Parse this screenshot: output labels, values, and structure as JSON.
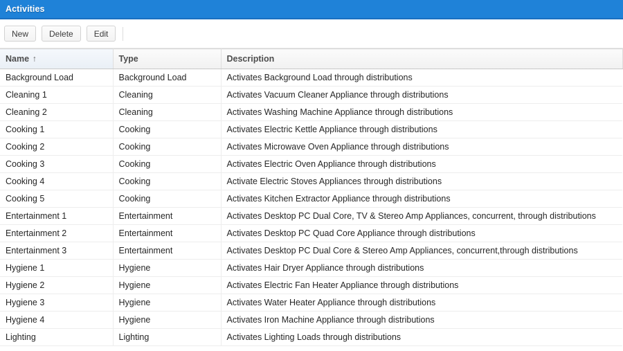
{
  "window": {
    "title": "Activities"
  },
  "toolbar": {
    "buttons": [
      {
        "label": "New",
        "name": "new-button"
      },
      {
        "label": "Delete",
        "name": "delete-button"
      },
      {
        "label": "Edit",
        "name": "edit-button"
      }
    ]
  },
  "grid": {
    "columns": [
      {
        "label": "Name",
        "sorted": true,
        "sort_indicator": "↑"
      },
      {
        "label": "Type",
        "sorted": false,
        "sort_indicator": ""
      },
      {
        "label": "Description",
        "sorted": false,
        "sort_indicator": ""
      }
    ],
    "rows": [
      {
        "name": "Background Load",
        "type": "Background Load",
        "description": "Activates Background Load through distributions"
      },
      {
        "name": "Cleaning 1",
        "type": "Cleaning",
        "description": "Activates Vacuum Cleaner Appliance through distributions"
      },
      {
        "name": "Cleaning 2",
        "type": "Cleaning",
        "description": "Activates Washing Machine Appliance through distributions"
      },
      {
        "name": "Cooking 1",
        "type": "Cooking",
        "description": "Activates Electric Kettle Appliance through distributions"
      },
      {
        "name": "Cooking 2",
        "type": "Cooking",
        "description": "Activates Microwave Oven Appliance through distributions"
      },
      {
        "name": "Cooking 3",
        "type": "Cooking",
        "description": "Activates Electric Oven Appliance through distributions"
      },
      {
        "name": "Cooking 4",
        "type": "Cooking",
        "description": "Activate Electric Stoves Appliances through distributions"
      },
      {
        "name": "Cooking 5",
        "type": "Cooking",
        "description": "Activates Kitchen Extractor Appliance through distributions"
      },
      {
        "name": "Entertainment 1",
        "type": "Entertainment",
        "description": "Activates Desktop PC Dual Core, TV & Stereo Amp Appliances, concurrent, through distributions"
      },
      {
        "name": "Entertainment 2",
        "type": "Entertainment",
        "description": "Activates Desktop PC Quad Core Appliance through distributions"
      },
      {
        "name": "Entertainment 3",
        "type": "Entertainment",
        "description": "Activates Desktop PC Dual Core & Stereo Amp Appliances, concurrent,through distributions"
      },
      {
        "name": "Hygiene 1",
        "type": "Hygiene",
        "description": "Activates Hair Dryer Appliance through distributions"
      },
      {
        "name": "Hygiene 2",
        "type": "Hygiene",
        "description": "Activates Electric Fan Heater Appliance through distributions"
      },
      {
        "name": "Hygiene 3",
        "type": "Hygiene",
        "description": "Activates Water Heater Appliance through distributions"
      },
      {
        "name": "Hygiene 4",
        "type": "Hygiene",
        "description": "Activates Iron Machine Appliance through distributions"
      },
      {
        "name": "Lighting",
        "type": "Lighting",
        "description": "Activates Lighting Loads through distributions"
      }
    ]
  },
  "colors": {
    "titlebar_bg": "#1f82d8",
    "titlebar_border": "#1a6fc0",
    "header_sorted_bg": "#e9eff6",
    "row_border": "#ededed"
  }
}
